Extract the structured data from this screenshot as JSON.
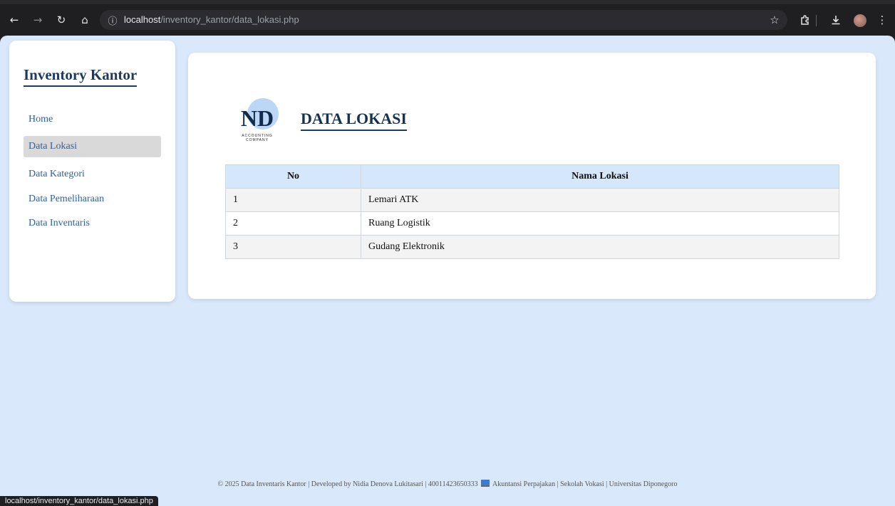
{
  "browser": {
    "url_host": "localhost",
    "url_path": "/inventory_kantor/data_lokasi.php",
    "status_url": "localhost/inventory_kantor/data_lokasi.php",
    "icons": [
      "back-icon",
      "forward-icon",
      "reload-icon",
      "home-icon",
      "info-icon",
      "star-icon",
      "extensions-icon",
      "download-icon",
      "profile-avatar",
      "menu-icon"
    ]
  },
  "sidebar": {
    "brand": "Inventory Kantor",
    "items": [
      {
        "label": "Home",
        "active": false
      },
      {
        "label": "Data Lokasi",
        "active": true
      },
      {
        "label": "Data Kategori",
        "active": false
      },
      {
        "label": "Data Pemeliharaan",
        "active": false
      },
      {
        "label": "Data Inventaris",
        "active": false
      }
    ]
  },
  "main": {
    "title": "DATA LOKASI",
    "logo": {
      "monogram": "ND",
      "caption_1": "ACCOUNTING",
      "caption_2": "COMPANY"
    },
    "table": {
      "headers": [
        "No",
        "Nama Lokasi"
      ],
      "rows": [
        [
          "1",
          "Lemari ATK"
        ],
        [
          "2",
          "Ruang Logistik"
        ],
        [
          "3",
          "Gudang Elektronik"
        ]
      ]
    }
  },
  "footer": {
    "text_left": "© 2025 Data Inventaris Kantor | Developed by Nidia Denova Lukitasari | 40011423650333",
    "text_right": "Akuntansi Perpajakan | Sekolah Vokasi | Universitas Diponegoro"
  },
  "colors": {
    "page_bg": "#d9e9fb",
    "header_bg": "#d4e7fb",
    "nav_link": "#2f5fa6",
    "brand": "#1f3a5f"
  }
}
